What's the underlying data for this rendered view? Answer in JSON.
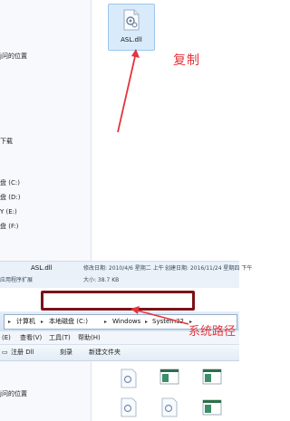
{
  "top": {
    "nav_items": [
      "j问的位置",
      "下载",
      "盘 (C:)",
      "盘 (D:)",
      "Y (E:)",
      "盘 (F:)"
    ],
    "file_name": "ASL.dll",
    "annotation": "复制",
    "details": {
      "name": "ASL.dll",
      "modified": "修改日期: 2010/4/6 星期二 上午 ...",
      "created": "创建日期: 2016/11/24 星期四 下午",
      "type": "应用程序扩展",
      "size": "大小: 38.7 KB"
    }
  },
  "bottom": {
    "breadcrumbs": [
      "计算机",
      "本地磁盘 (C:)",
      "Windows",
      "System32"
    ],
    "menu": [
      "(E)",
      "查看(V)",
      "工具(T)",
      "帮助(H)"
    ],
    "toolbar": [
      "注册 Dll",
      "刻录",
      "新建文件夹"
    ],
    "nav_items": [
      "j问的位置"
    ],
    "annotation": "系统路径"
  },
  "colors": {
    "annotation": "#e4343c",
    "highlight": "#7b1216",
    "selection": "#d9ebfb"
  }
}
